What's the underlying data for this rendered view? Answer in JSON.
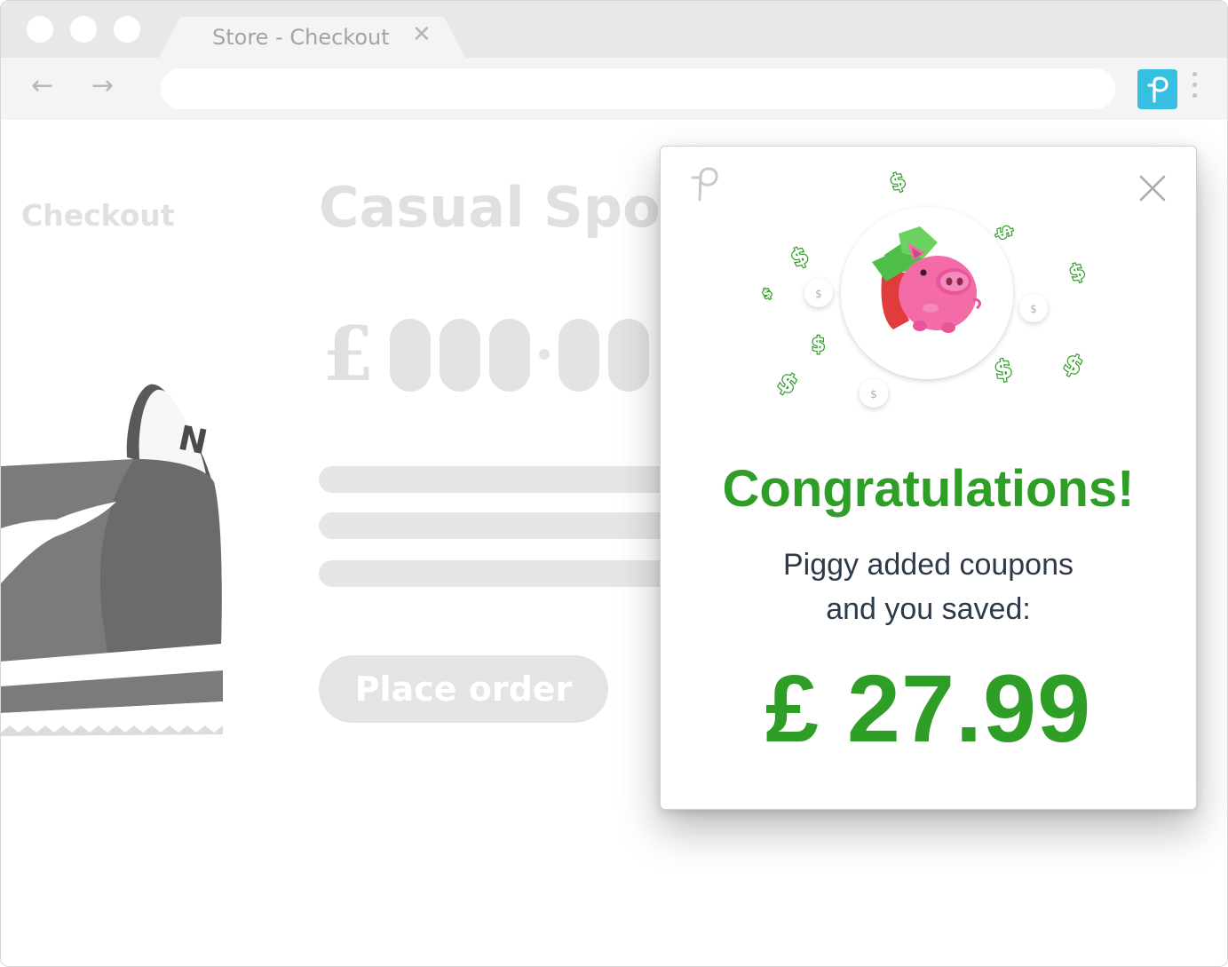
{
  "browser": {
    "tab_title": "Store - Checkout",
    "tab_close_glyph": "✕",
    "back_glyph": "←",
    "forward_glyph": "→",
    "address_value": "",
    "extension_icon": "piggy-p-logo-icon",
    "extension_color": "#35bfe0"
  },
  "store": {
    "checkout_label": "Checkout",
    "product_title": "Casual Sport",
    "price_symbol": "£",
    "place_order_label": "Place order"
  },
  "popup": {
    "heading": "Congratulations!",
    "message_line1": "Piggy added coupons",
    "message_line2": "and you saved:",
    "savings": "£ 27.99",
    "accent_color": "#2f9e27",
    "icons": [
      "piggy-logo-icon",
      "close-icon",
      "piggy-bank-mascot-icon",
      "dollar-sign-icon",
      "coin-icon"
    ]
  }
}
